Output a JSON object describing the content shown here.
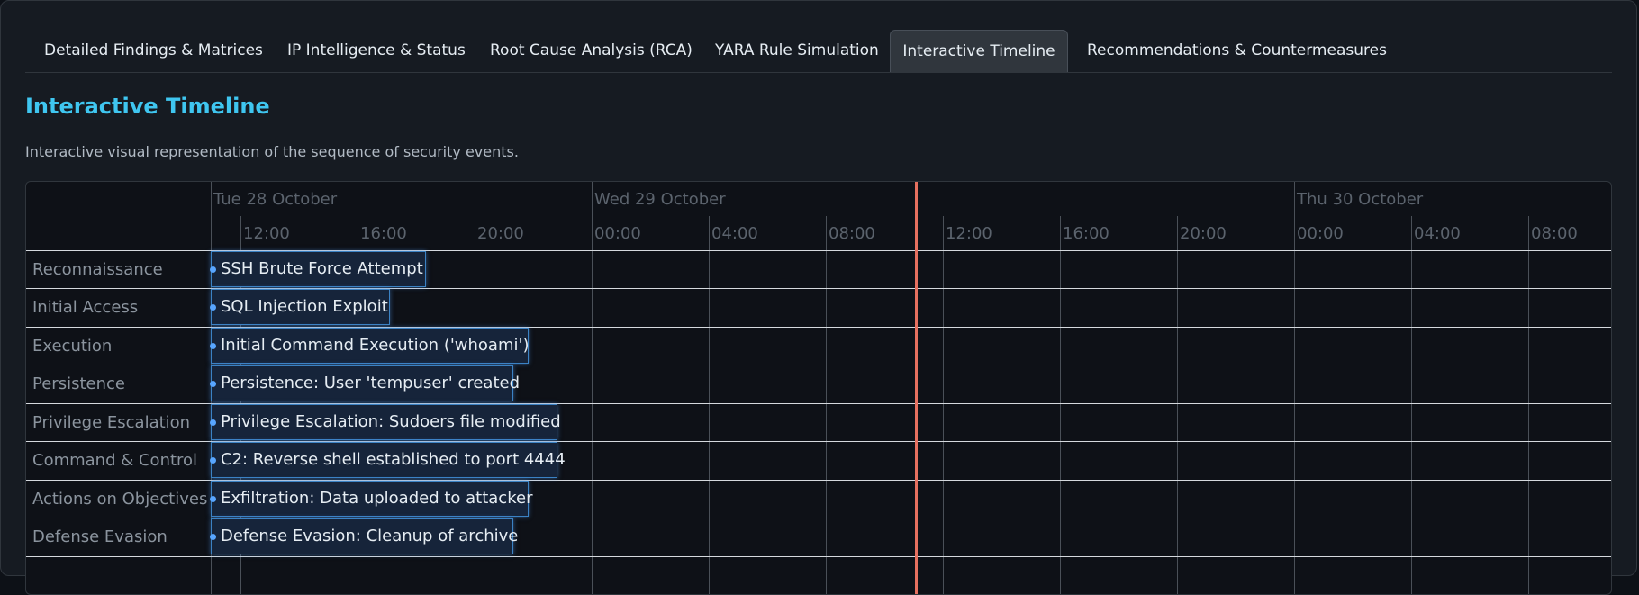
{
  "tabs": [
    {
      "label": "Detailed Findings & Matrices"
    },
    {
      "label": "IP Intelligence & Status"
    },
    {
      "label": "Root Cause Analysis (RCA)"
    },
    {
      "label": "YARA Rule Simulation"
    },
    {
      "label": "Interactive Timeline"
    },
    {
      "label": "Recommendations & Countermeasures"
    }
  ],
  "active_tab": "Interactive Timeline",
  "section": {
    "title": "Interactive Timeline",
    "description": "Interactive visual representation of the sequence of security events."
  },
  "timeline": {
    "days": [
      "Tue 28 October",
      "Wed 29 October",
      "Thu 30 October"
    ],
    "hours": [
      "12:00",
      "16:00",
      "20:00",
      "00:00",
      "04:00",
      "08:00",
      "12:00",
      "16:00",
      "20:00",
      "00:00",
      "04:00",
      "08:00"
    ],
    "lanes": [
      {
        "label": "Reconnaissance",
        "event": "SSH Brute Force Attempt"
      },
      {
        "label": "Initial Access",
        "event": "SQL Injection Exploit"
      },
      {
        "label": "Execution",
        "event": "Initial Command Execution ('whoami')"
      },
      {
        "label": "Persistence",
        "event": "Persistence: User 'tempuser' created"
      },
      {
        "label": "Privilege Escalation",
        "event": "Privilege Escalation: Sudoers file modified"
      },
      {
        "label": "Command & Control",
        "event": "C2: Reverse shell established to port 4444"
      },
      {
        "label": "Actions on Objectives",
        "event": "Exfiltration: Data uploaded to attacker"
      },
      {
        "label": "Defense Evasion",
        "event": "Defense Evasion: Cleanup of archive"
      }
    ]
  },
  "colors": {
    "accent": "#3fc6f0",
    "event_border": "#3b82c4",
    "event_dot": "#58a6ff",
    "current_time_marker": "#e5705f"
  }
}
